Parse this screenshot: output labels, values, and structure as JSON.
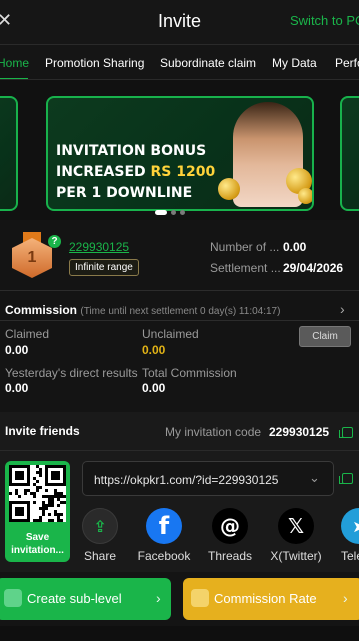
{
  "header": {
    "back_icon": "close-icon",
    "title": "Invite",
    "switch_label": "Switch to PC"
  },
  "tabs": [
    {
      "label": "Home"
    },
    {
      "label": "Promotion Sharing"
    },
    {
      "label": "Subordinate claim"
    },
    {
      "label": "My Data"
    },
    {
      "label": "Performance"
    }
  ],
  "banner": {
    "line1": "INVITATION BONUS",
    "line2_prefix": "INCREASED ",
    "line2_highlight": "RS 1200",
    "line3": "PER 1 DOWNLINE",
    "highlight_color": "#ffd33a"
  },
  "profile": {
    "level": "1",
    "user_id": "229930125",
    "range_label": "Infinite range",
    "stats": [
      {
        "label": "Number of ...",
        "value": "0.00"
      },
      {
        "label": "Settlement ...",
        "value": "29/04/2026"
      }
    ]
  },
  "commission": {
    "title": "Commission",
    "subtitle": "(Time until next settlement 0 day(s) 11:04:17)",
    "claimed_label": "Claimed",
    "claimed_value": "0.00",
    "unclaimed_label": "Unclaimed",
    "unclaimed_value": "0.00",
    "claim_button": "Claim",
    "direct_label": "Yesterday's direct results",
    "direct_value": "0.00",
    "total_label": "Total Commission",
    "total_value": "0.00"
  },
  "invite": {
    "title": "Invite friends",
    "code_label": "My invitation code",
    "code_value": "229930125",
    "save_label": "Save invitation...",
    "url": "https://okpkr1.com/?id=229930125",
    "share_items": [
      {
        "label": "Share",
        "icon": "share-icon"
      },
      {
        "label": "Facebook",
        "icon": "facebook-icon"
      },
      {
        "label": "Threads",
        "icon": "threads-icon"
      },
      {
        "label": "X(Twitter)",
        "icon": "x-twitter-icon"
      },
      {
        "label": "Telegram",
        "icon": "telegram-icon"
      }
    ]
  },
  "actions": {
    "create_label": "Create sub-level",
    "rate_label": "Commission Rate"
  },
  "colors": {
    "accent": "#1ab54a",
    "gold": "#e6b01e",
    "background": "#141414"
  }
}
